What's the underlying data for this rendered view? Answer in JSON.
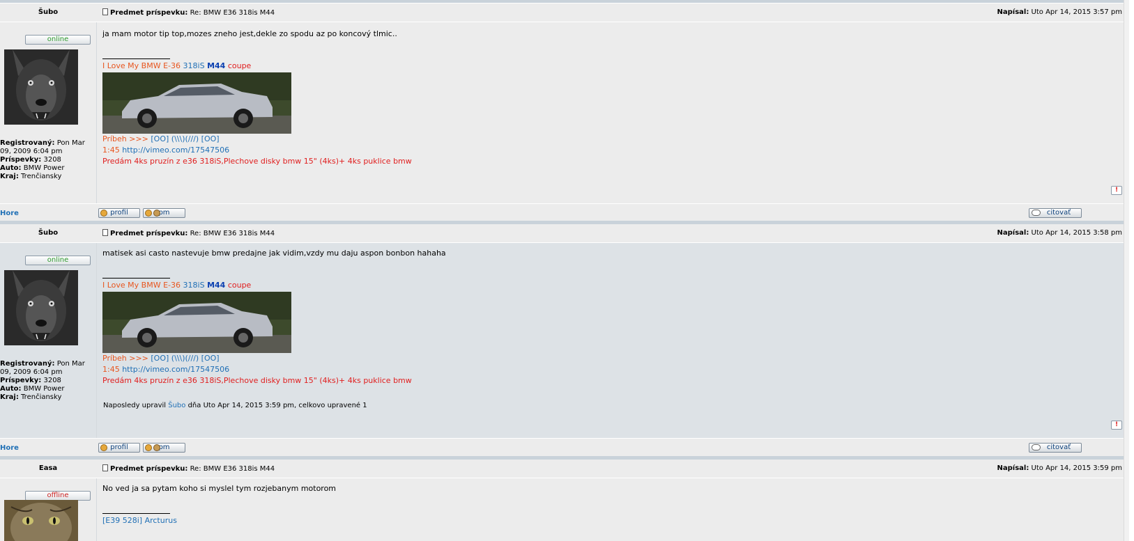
{
  "labels": {
    "subject_label": "Predmet príspevku:",
    "posted_label": "Napísal:",
    "registered_label": "Registrovaný:",
    "posts_label": "Príspevky:",
    "car_label": "Auto:",
    "region_label": "Kraj:",
    "top_link": "Hore",
    "profile_btn": "profil",
    "pm_btn": "pm",
    "quote_btn": "citovať",
    "report_icon": "!"
  },
  "posts": [
    {
      "author": "Šubo",
      "status": "online",
      "subject": "Re: BMW E36 318is M44",
      "posted": "Uto Apr 14, 2015 3:57 pm",
      "message": "ja mam motor tip top,mozes zneho jest,dekle zo spodu az po koncový tlmic..",
      "registered": "Pon Mar 09, 2009 6:04 pm",
      "post_count": "3208",
      "car": "BMW Power",
      "region": "Trenčiansky"
    },
    {
      "author": "Šubo",
      "status": "online",
      "subject": "Re: BMW E36 318is M44",
      "posted": "Uto Apr 14, 2015 3:58 pm",
      "message": "matisek asi casto nastevuje bmw predajne jak vidim,vzdy mu daju aspon bonbon hahaha",
      "registered": "Pon Mar 09, 2009 6:04 pm",
      "post_count": "3208",
      "car": "BMW Power",
      "region": "Trenčiansky",
      "edited_prefix": "Naposledy upravil ",
      "edited_user": "Šubo",
      "edited_suffix": " dňa Uto Apr 14, 2015 3:59 pm, celkovo upravené 1"
    },
    {
      "author": "Easa",
      "status": "offline",
      "subject": "Re: BMW E36 318is M44",
      "posted": "Uto Apr 14, 2015 3:59 pm",
      "message": "No ved ja sa pytam koho si myslel tym rozjebanym motorom",
      "signature_text": "[E39 528i] Arcturus"
    }
  ],
  "signature": {
    "love": "I Love My BMW E-36",
    "model": "318iS",
    "engine": "M44",
    "coupe": "coupe",
    "story_label": "Príbeh >>>",
    "story_links": "[OO] (\\\\\\)(///) [OO]",
    "video_time": "1:45",
    "video_url": "http://vimeo.com/17547506",
    "sale": "Predám 4ks pruzín z e36 318iS,Plechove disky bmw 15\" (4ks)+ 4ks puklice bmw"
  },
  "colors": {
    "row_light": "#ececec",
    "row_blue": "#dde2e6",
    "separator": "#c9d2da",
    "link": "#1f6fb5",
    "accent_orange": "#e8551e",
    "accent_red": "#e01e1e",
    "online_green": "#2e9a2e"
  }
}
